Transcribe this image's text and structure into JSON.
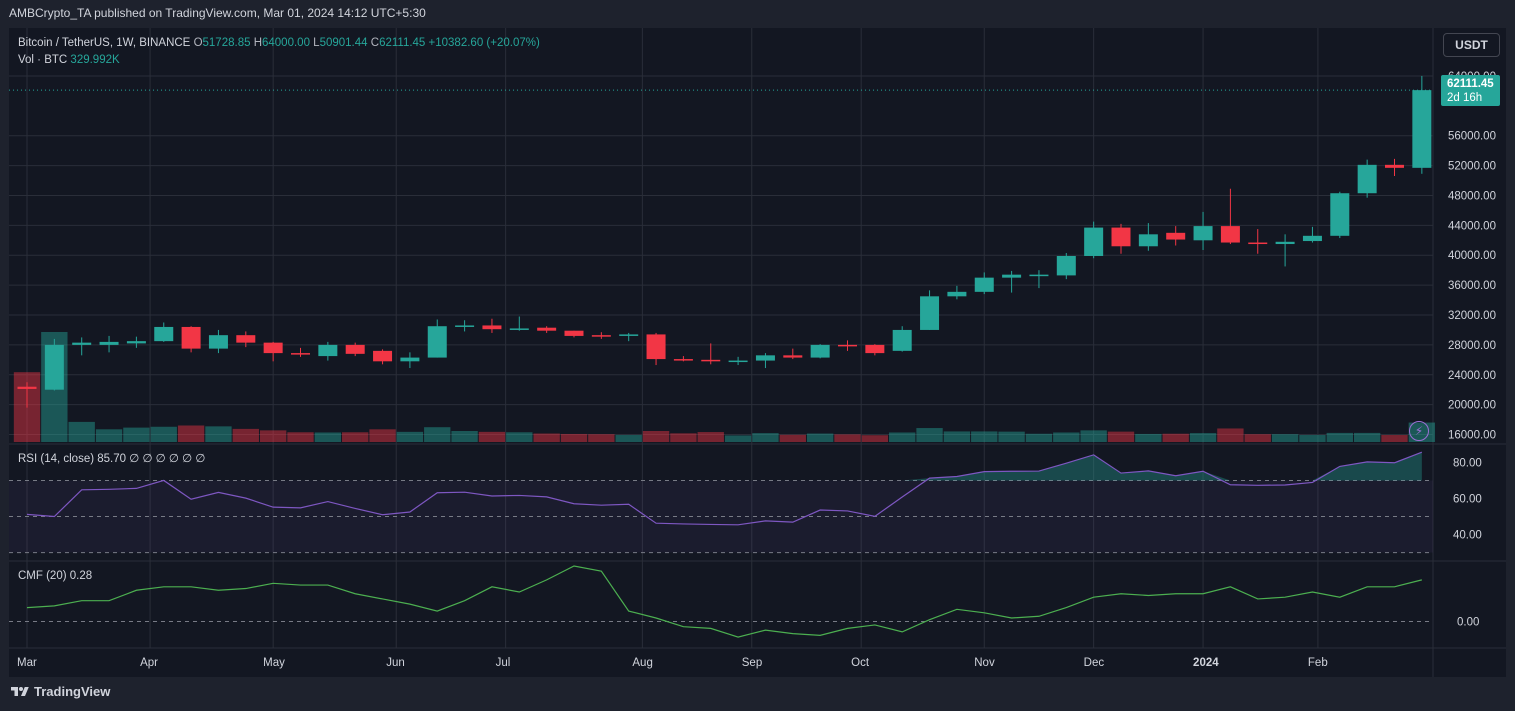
{
  "header": {
    "published": "AMBCrypto_TA published on TradingView.com, Mar 01, 2024 14:12 UTC+5:30"
  },
  "legend": {
    "symbol": "Bitcoin / TetherUS, 1W, BINANCE",
    "o_label": "O",
    "o_value": "51728.85",
    "h_label": "H",
    "h_value": "64000.00",
    "l_label": "L",
    "l_value": "50901.44",
    "c_label": "C",
    "c_value": "62111.45",
    "change": "+10382.60 (+20.07%)",
    "vol_label": "Vol · BTC",
    "vol_value": "329.992K"
  },
  "rsi": {
    "label": "RSI (14, close)",
    "value": "85.70",
    "placeholders": "∅ ∅ ∅ ∅ ∅ ∅"
  },
  "cmf": {
    "label": "CMF (20)",
    "value": "0.28"
  },
  "currency_button": "USDT",
  "last_price": {
    "value": "62111.45",
    "countdown": "2d 16h"
  },
  "footer": {
    "brand": "TradingView"
  },
  "colors": {
    "up": "#26a69a",
    "down": "#f23645",
    "rsi": "#7e57c2",
    "cmf": "#4caf50",
    "bg": "#131722",
    "grid": "#2a2e39"
  },
  "icons": {
    "alert": "lightning-icon",
    "logo": "tradingview-logo-icon"
  },
  "chart_data": [
    {
      "type": "candlestick",
      "title": "Bitcoin / TetherUS, 1W, BINANCE",
      "ylim": [
        15000,
        66000
      ],
      "y_ticks": [
        "64000.00",
        "56000.00",
        "52000.00",
        "48000.00",
        "44000.00",
        "40000.00",
        "36000.00",
        "32000.00",
        "28000.00",
        "24000.00",
        "20000.00",
        "16000.00"
      ],
      "x_ticks": [
        "Mar",
        "Apr",
        "May",
        "Jun",
        "Jul",
        "Aug",
        "Sep",
        "Oct",
        "Nov",
        "Dec",
        "2024",
        "Feb"
      ],
      "candles": [
        {
          "o": 22400,
          "h": 23000,
          "l": 19600,
          "c": 22100
        },
        {
          "o": 22000,
          "h": 28800,
          "l": 21900,
          "c": 28000
        },
        {
          "o": 28000,
          "h": 29000,
          "l": 26600,
          "c": 28300
        },
        {
          "o": 28000,
          "h": 29200,
          "l": 27000,
          "c": 28400
        },
        {
          "o": 28200,
          "h": 29100,
          "l": 27600,
          "c": 28500
        },
        {
          "o": 28500,
          "h": 31000,
          "l": 28400,
          "c": 30400
        },
        {
          "o": 30400,
          "h": 30500,
          "l": 27000,
          "c": 27500
        },
        {
          "o": 27500,
          "h": 30000,
          "l": 26900,
          "c": 29300
        },
        {
          "o": 29300,
          "h": 29800,
          "l": 27700,
          "c": 28300
        },
        {
          "o": 28300,
          "h": 28400,
          "l": 25800,
          "c": 26900
        },
        {
          "o": 26900,
          "h": 27600,
          "l": 26400,
          "c": 26700
        },
        {
          "o": 26500,
          "h": 28400,
          "l": 25900,
          "c": 28000
        },
        {
          "o": 28000,
          "h": 28300,
          "l": 26500,
          "c": 26800
        },
        {
          "o": 27200,
          "h": 27400,
          "l": 25400,
          "c": 25800
        },
        {
          "o": 25800,
          "h": 27000,
          "l": 24900,
          "c": 26300
        },
        {
          "o": 26300,
          "h": 31400,
          "l": 26300,
          "c": 30500
        },
        {
          "o": 30500,
          "h": 31300,
          "l": 29800,
          "c": 30600
        },
        {
          "o": 30600,
          "h": 31500,
          "l": 29600,
          "c": 30100
        },
        {
          "o": 30200,
          "h": 31800,
          "l": 29900,
          "c": 30200
        },
        {
          "o": 30300,
          "h": 30500,
          "l": 29600,
          "c": 29900
        },
        {
          "o": 29900,
          "h": 29900,
          "l": 29000,
          "c": 29200
        },
        {
          "o": 29300,
          "h": 29700,
          "l": 28800,
          "c": 29200
        },
        {
          "o": 29200,
          "h": 29600,
          "l": 28500,
          "c": 29400
        },
        {
          "o": 29400,
          "h": 29600,
          "l": 25300,
          "c": 26100
        },
        {
          "o": 26100,
          "h": 26500,
          "l": 25800,
          "c": 26000
        },
        {
          "o": 26000,
          "h": 28200,
          "l": 25400,
          "c": 25900
        },
        {
          "o": 25800,
          "h": 26400,
          "l": 25300,
          "c": 25900
        },
        {
          "o": 25900,
          "h": 26900,
          "l": 24900,
          "c": 26600
        },
        {
          "o": 26600,
          "h": 27500,
          "l": 26100,
          "c": 26300
        },
        {
          "o": 26300,
          "h": 28100,
          "l": 26200,
          "c": 28000
        },
        {
          "o": 28000,
          "h": 28600,
          "l": 27200,
          "c": 27900
        },
        {
          "o": 28000,
          "h": 28100,
          "l": 26600,
          "c": 26900
        },
        {
          "o": 27200,
          "h": 30500,
          "l": 27100,
          "c": 30000
        },
        {
          "o": 30000,
          "h": 35300,
          "l": 30000,
          "c": 34500
        },
        {
          "o": 34500,
          "h": 35900,
          "l": 34100,
          "c": 35100
        },
        {
          "o": 35100,
          "h": 37700,
          "l": 34800,
          "c": 37000
        },
        {
          "o": 37000,
          "h": 37900,
          "l": 35000,
          "c": 37400
        },
        {
          "o": 37400,
          "h": 38000,
          "l": 35600,
          "c": 37400
        },
        {
          "o": 37300,
          "h": 40300,
          "l": 36800,
          "c": 39900
        },
        {
          "o": 39900,
          "h": 44500,
          "l": 39600,
          "c": 43700
        },
        {
          "o": 43700,
          "h": 44200,
          "l": 40200,
          "c": 41200
        },
        {
          "o": 41200,
          "h": 44300,
          "l": 40600,
          "c": 42800
        },
        {
          "o": 43000,
          "h": 43900,
          "l": 41300,
          "c": 42100
        },
        {
          "o": 42000,
          "h": 45800,
          "l": 40700,
          "c": 43900
        },
        {
          "o": 43900,
          "h": 48900,
          "l": 41500,
          "c": 41700
        },
        {
          "o": 41700,
          "h": 43500,
          "l": 40200,
          "c": 41500
        },
        {
          "o": 41500,
          "h": 42800,
          "l": 38500,
          "c": 41800
        },
        {
          "o": 41900,
          "h": 43800,
          "l": 41700,
          "c": 42600
        },
        {
          "o": 42600,
          "h": 48500,
          "l": 42300,
          "c": 48300
        },
        {
          "o": 48300,
          "h": 52800,
          "l": 47700,
          "c": 52100
        },
        {
          "o": 52100,
          "h": 52900,
          "l": 50600,
          "c": 51700
        },
        {
          "o": 51700,
          "h": 64000,
          "l": 50900,
          "c": 62100
        }
      ],
      "volume": [
        330,
        520,
        95,
        60,
        68,
        72,
        78,
        74,
        62,
        55,
        46,
        45,
        46,
        60,
        48,
        70,
        52,
        48,
        46,
        40,
        38,
        37,
        33,
        52,
        41,
        47,
        31,
        42,
        34,
        40,
        36,
        32,
        45,
        66,
        50,
        50,
        49,
        39,
        45,
        55,
        49,
        38,
        39,
        42,
        64,
        37,
        37,
        33,
        43,
        43,
        33,
        92
      ]
    },
    {
      "type": "line",
      "title": "RSI (14, close)",
      "ylim": [
        27,
        88
      ],
      "y_ticks": [
        "80.00",
        "60.00",
        "40.00"
      ],
      "bands": [
        70,
        50,
        30
      ],
      "values": [
        51.2,
        50.0,
        64.8,
        65.1,
        65.6,
        70.0,
        59.6,
        63.4,
        60.2,
        55.2,
        54.8,
        58.3,
        54.5,
        51.0,
        52.5,
        63.2,
        63.5,
        61.4,
        61.7,
        60.9,
        57.1,
        56.3,
        56.8,
        46.3,
        45.9,
        45.6,
        45.4,
        47.6,
        46.9,
        53.6,
        53.1,
        50.1,
        60.8,
        71.3,
        72.2,
        74.9,
        75.1,
        75.2,
        79.6,
        84.2,
        74.1,
        75.3,
        72.6,
        75.1,
        67.6,
        67.3,
        67.5,
        68.9,
        77.8,
        80.3,
        79.8,
        85.7
      ]
    },
    {
      "type": "line",
      "title": "CMF (20)",
      "ylim": [
        -0.13,
        0.32
      ],
      "y_ticks": [
        "0.00"
      ],
      "values": [
        0.08,
        0.09,
        0.12,
        0.12,
        0.18,
        0.2,
        0.2,
        0.18,
        0.19,
        0.22,
        0.21,
        0.21,
        0.16,
        0.13,
        0.1,
        0.06,
        0.12,
        0.2,
        0.17,
        0.24,
        0.32,
        0.29,
        0.06,
        0.02,
        -0.03,
        -0.04,
        -0.09,
        -0.05,
        -0.07,
        -0.08,
        -0.04,
        -0.02,
        -0.06,
        0.01,
        0.07,
        0.05,
        0.02,
        0.03,
        0.08,
        0.14,
        0.16,
        0.15,
        0.16,
        0.16,
        0.2,
        0.13,
        0.14,
        0.17,
        0.14,
        0.2,
        0.2,
        0.24
      ]
    }
  ]
}
